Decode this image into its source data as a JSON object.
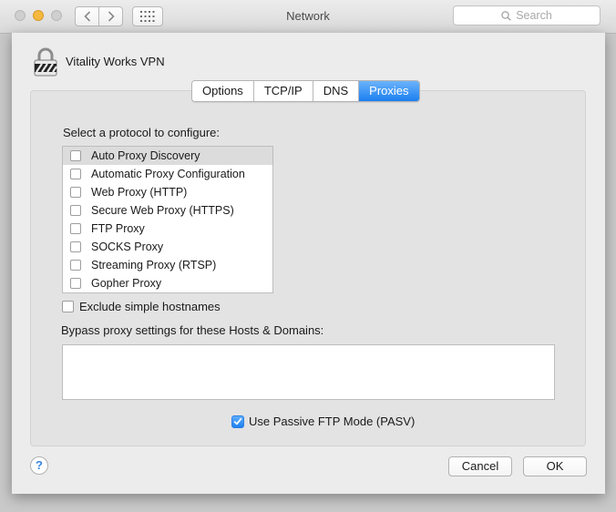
{
  "window": {
    "title": "Network",
    "search_placeholder": "Search"
  },
  "connection": {
    "name": "Vitality Works VPN"
  },
  "tabs": [
    {
      "label": "Options",
      "active": false
    },
    {
      "label": "TCP/IP",
      "active": false
    },
    {
      "label": "DNS",
      "active": false
    },
    {
      "label": "Proxies",
      "active": true
    }
  ],
  "proxies": {
    "select_label": "Select a protocol to configure:",
    "protocols": [
      {
        "label": "Auto Proxy Discovery",
        "checked": false,
        "selected": true
      },
      {
        "label": "Automatic Proxy Configuration",
        "checked": false,
        "selected": false
      },
      {
        "label": "Web Proxy (HTTP)",
        "checked": false,
        "selected": false
      },
      {
        "label": "Secure Web Proxy (HTTPS)",
        "checked": false,
        "selected": false
      },
      {
        "label": "FTP Proxy",
        "checked": false,
        "selected": false
      },
      {
        "label": "SOCKS Proxy",
        "checked": false,
        "selected": false
      },
      {
        "label": "Streaming Proxy (RTSP)",
        "checked": false,
        "selected": false
      },
      {
        "label": "Gopher Proxy",
        "checked": false,
        "selected": false
      }
    ],
    "exclude_label": "Exclude simple hostnames",
    "exclude_checked": false,
    "bypass_label": "Bypass proxy settings for these Hosts & Domains:",
    "bypass_value": "",
    "pasv_label": "Use Passive FTP Mode (PASV)",
    "pasv_checked": true
  },
  "buttons": {
    "help": "?",
    "cancel": "Cancel",
    "ok": "OK"
  },
  "colors": {
    "accent": "#1b7ff0",
    "minimize": "#f5b93f"
  },
  "icons": [
    "close-icon",
    "minimize-icon",
    "zoom-icon",
    "back-icon",
    "forward-icon",
    "grid-icon",
    "search-icon",
    "lock-icon",
    "checkmark-icon"
  ]
}
